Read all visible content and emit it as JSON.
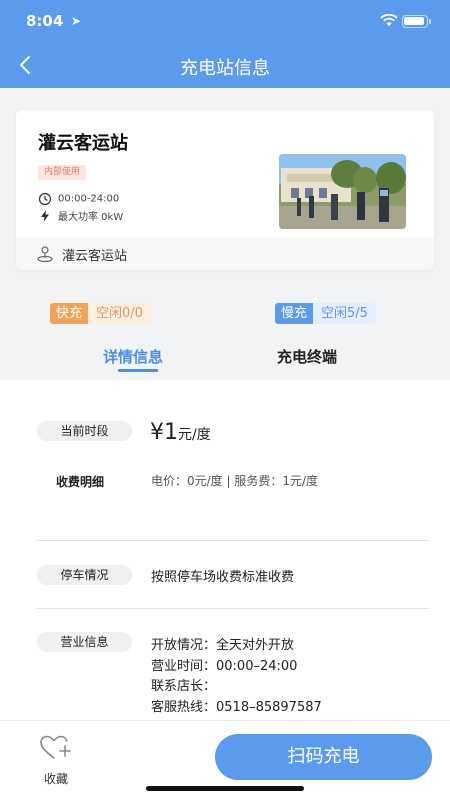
{
  "status": {
    "time": "8:04"
  },
  "nav": {
    "title": "充电站信息"
  },
  "station": {
    "name": "灌云客运站",
    "tag": "内部使用",
    "hours": "00:00-24:00",
    "max_power": "最大功率 0kW",
    "address": "灌云客运站"
  },
  "charge": {
    "fast_label": "快充",
    "fast_value": "空闲0/0",
    "slow_label": "慢充",
    "slow_value": "空闲5/5"
  },
  "tabs": [
    {
      "label": "详情信息"
    },
    {
      "label": "充电终端"
    }
  ],
  "detail": {
    "current_period_label": "当前时段",
    "price_big": "¥1",
    "price_unit": "元/度",
    "fee_detail_label": "收费明细",
    "fee_detail_value": "电价：0元/度 | 服务费：1元/度",
    "parking_label": "停车情况",
    "parking_value": "按照停车场收费标准收费",
    "business_label": "营业信息",
    "business_lines": [
      "开放情况：全天对外开放",
      "营业时间：00:00–24:00",
      "联系店长：",
      "客服热线：0518–85897587"
    ]
  },
  "bottom": {
    "favorite_label": "收藏",
    "scan_label": "扫码充电"
  },
  "colors": {
    "primary": "#5b9bee",
    "fast": "#f1a35a",
    "tag": "#e8795a"
  }
}
